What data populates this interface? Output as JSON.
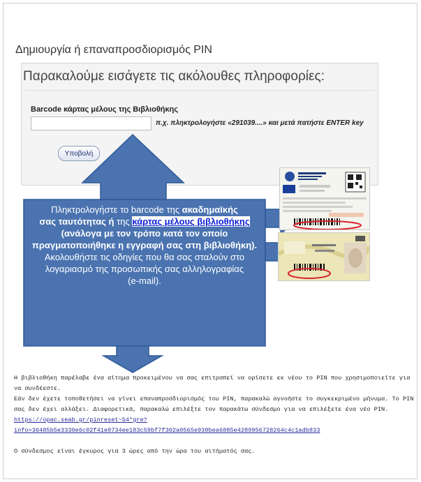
{
  "page": {
    "title": "Δημιουργία ή επαναπροσδιορισμός PIN"
  },
  "form": {
    "heading": "Παρακαλούμε εισάγετε τις ακόλουθες πληροφορίες:",
    "field_label": "Barcode κάρτας μέλους της Βιβλιοθήκης",
    "field_value": "",
    "hint": "π.χ. πληκτρολογήστε «291039....» και μετά πατήστε ENTER key",
    "submit_label": "Υποβολή"
  },
  "callout": {
    "line1": "Πληκτρολογήστε το barcode της ",
    "line1_bold": "ακαδημαϊκής",
    "line2_bold": "σας ταυτότητας ή",
    "line2": " της ",
    "link": "κάρτας μέλους βιβλιοθήκης",
    "after_link": " (ανάλογα με τον τρόπο κατά τον οποίο πραγματοποιήθηκε η εγγραφή σας στη βιβλιοθήκη).",
    "line_follow": "Ακολουθήστε τις οδηγίες που θα σας σταλούν στο λογαριασμό της προσωπικής σας αλληλογραφίας",
    "line_email": "(e-mail).",
    "fill_color": "#4a73b0"
  },
  "cards": {
    "academic_barcode": "2191030012345",
    "library_barcode": "0000003281"
  },
  "email_message": {
    "line1": "Η βιβλιοθήκη παρέλαβε ένα αίτημα προκειμένου να σας επιτραπεί να ορίσετε εκ νέου το PIN που χρησιμοποιείτε για να συνδέεστε.",
    "line2": "Εάν δεν έχετε τοποθετήσει να γίνει επαναπροσδιορισμός του PIN, παρακαλώ αγνοήστε το συγκεκριμένο μήνυμα. Το PIN σας δεν έχει αλλάξει. Διαφορετικά, παρακαλώ επιλέξτε τον παρακάτω σύνδεσμο για να επιλέξετε ένα νέο PIN.",
    "link": "https://opac.seab.gr/pinreset~S4*gre?info=36485b5e3330e6c02f41e0734ee183c59bf7f302a0565e930bea6885e4289956728264c4c1adb833",
    "line3": "Ο σύνδεσμος είναι έγκυρος για 3 ώρες από την ώρα του αιτήματός σας."
  }
}
